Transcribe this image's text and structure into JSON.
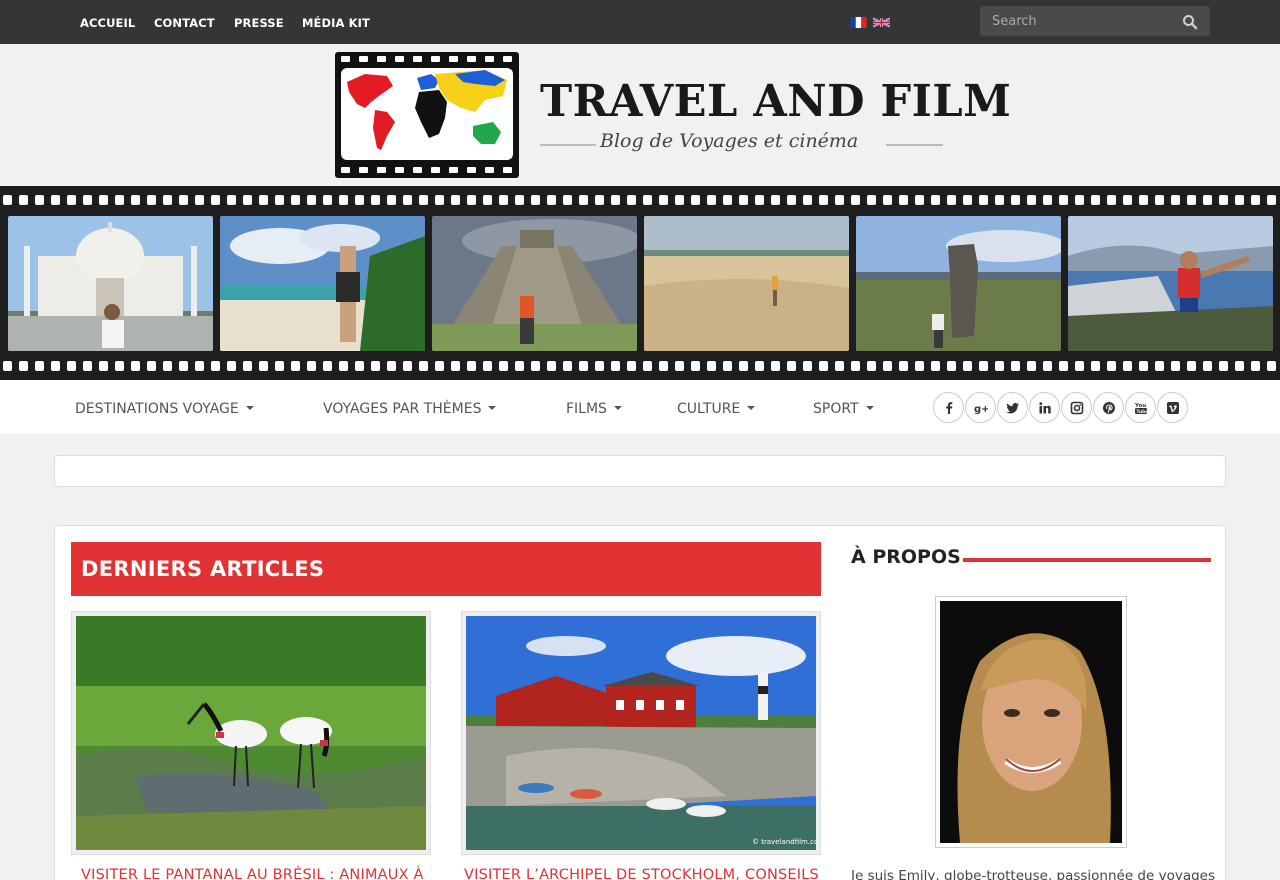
{
  "topbar": {
    "nav": [
      "ACCUEIL",
      "CONTACT",
      "PRESSE",
      "MÉDIA KIT"
    ],
    "languages": [
      "fr-flag",
      "uk-flag"
    ],
    "search_placeholder": "Search"
  },
  "logo": {
    "title": "TRAVEL AND FILM",
    "subtitle": "Blog de Voyages et cinéma"
  },
  "mainnav": {
    "items": [
      "DESTINATIONS VOYAGE",
      "VOYAGES PAR THÈMES",
      "FILMS",
      "CULTURE",
      "SPORT"
    ],
    "social_icons": [
      "facebook-icon",
      "google-plus-icon",
      "twitter-icon",
      "linkedin-icon",
      "instagram-icon",
      "pinterest-icon",
      "youtube-icon",
      "vimeo-icon"
    ]
  },
  "articles": {
    "heading": "DERNIERS ARTICLES",
    "items": [
      {
        "title": "VISITER LE PANTANAL AU BRÉSIL : ANIMAUX À"
      },
      {
        "title": "VISITER L’ARCHIPEL DE STOCKHOLM, CONSEILS"
      }
    ],
    "watermark": "© travelandfilm.com"
  },
  "sidebar": {
    "heading": "À PROPOS",
    "about_text": "Je suis Emily, globe-trotteuse, passionnée de voyages"
  },
  "colors": {
    "accent": "#e03232",
    "topbar": "#353535"
  }
}
